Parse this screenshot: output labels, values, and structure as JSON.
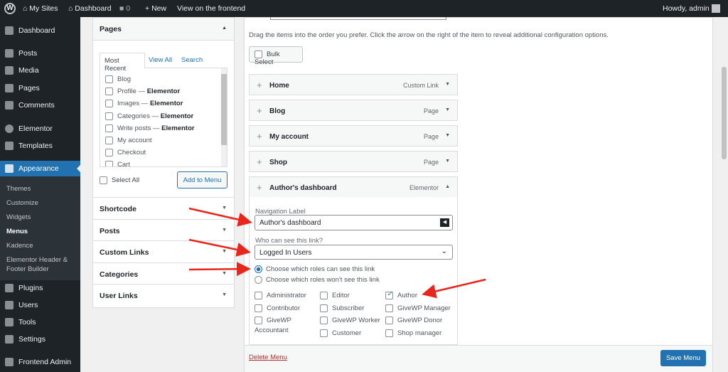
{
  "adminbar": {
    "my_sites": "My Sites",
    "dashboard": "Dashboard",
    "comments": "0",
    "new": "New",
    "view": "View on the frontend",
    "howdy": "Howdy, admin"
  },
  "sidebar": {
    "items": [
      "Dashboard",
      "Posts",
      "Media",
      "Pages",
      "Comments",
      "Elementor",
      "Templates",
      "Appearance",
      "Plugins",
      "Users",
      "Tools",
      "Settings",
      "Frontend Admin"
    ],
    "submenu": [
      "Themes",
      "Customize",
      "Widgets",
      "Menus",
      "Kadence",
      "Elementor Header &",
      "Footer Builder"
    ]
  },
  "pages_box": {
    "title": "Pages",
    "tabs": [
      "Most Recent",
      "View All",
      "Search"
    ],
    "list": [
      {
        "name": "Blog",
        "suffix": ""
      },
      {
        "name": "Profile — ",
        "suffix": "Elementor"
      },
      {
        "name": "Images — ",
        "suffix": "Elementor"
      },
      {
        "name": "Categories — ",
        "suffix": "Elementor"
      },
      {
        "name": "Write posts — ",
        "suffix": "Elementor"
      },
      {
        "name": "My account",
        "suffix": ""
      },
      {
        "name": "Checkout",
        "suffix": ""
      },
      {
        "name": "Cart",
        "suffix": ""
      }
    ],
    "select_all": "Select All",
    "add_button": "Add to Menu"
  },
  "accordions": [
    "Shortcode",
    "Posts",
    "Custom Links",
    "Categories",
    "User Links"
  ],
  "menu": {
    "instructions": "Drag the items into the order you prefer. Click the arrow on the right of the item to reveal additional configuration options.",
    "bulk_select": "Bulk Select",
    "items": [
      {
        "title": "Home",
        "type": "Custom Link"
      },
      {
        "title": "Blog",
        "type": "Page"
      },
      {
        "title": "My account",
        "type": "Page"
      },
      {
        "title": "Shop",
        "type": "Page"
      }
    ],
    "expanded": {
      "title": "Author's dashboard",
      "type": "Elementor",
      "nav_label": "Navigation Label",
      "nav_value": "Author's dashboard",
      "who_label": "Who can see this link?",
      "who_value": "Logged In Users",
      "radio_can": "Choose which roles can see this link",
      "radio_cant": "Choose which roles won't see this link",
      "roles": [
        {
          "name": "Administrator",
          "checked": false
        },
        {
          "name": "Editor",
          "checked": false
        },
        {
          "name": "Author",
          "checked": true
        },
        {
          "name": "Contributor",
          "checked": false
        },
        {
          "name": "Subscriber",
          "checked": false
        },
        {
          "name": "GiveWP Manager",
          "checked": false
        },
        {
          "name": "GiveWP",
          "name2": "Accountant",
          "checked": false
        },
        {
          "name": "GiveWP Worker",
          "checked": false
        },
        {
          "name": "GiveWP Donor",
          "checked": false
        },
        {
          "name": "Customer",
          "checked": false
        },
        {
          "name": "Shop manager",
          "checked": false
        }
      ]
    },
    "delete": "Delete Menu",
    "save": "Save Menu"
  },
  "colors": {
    "accent": "#2271b1",
    "arrow": "#e8261c"
  }
}
